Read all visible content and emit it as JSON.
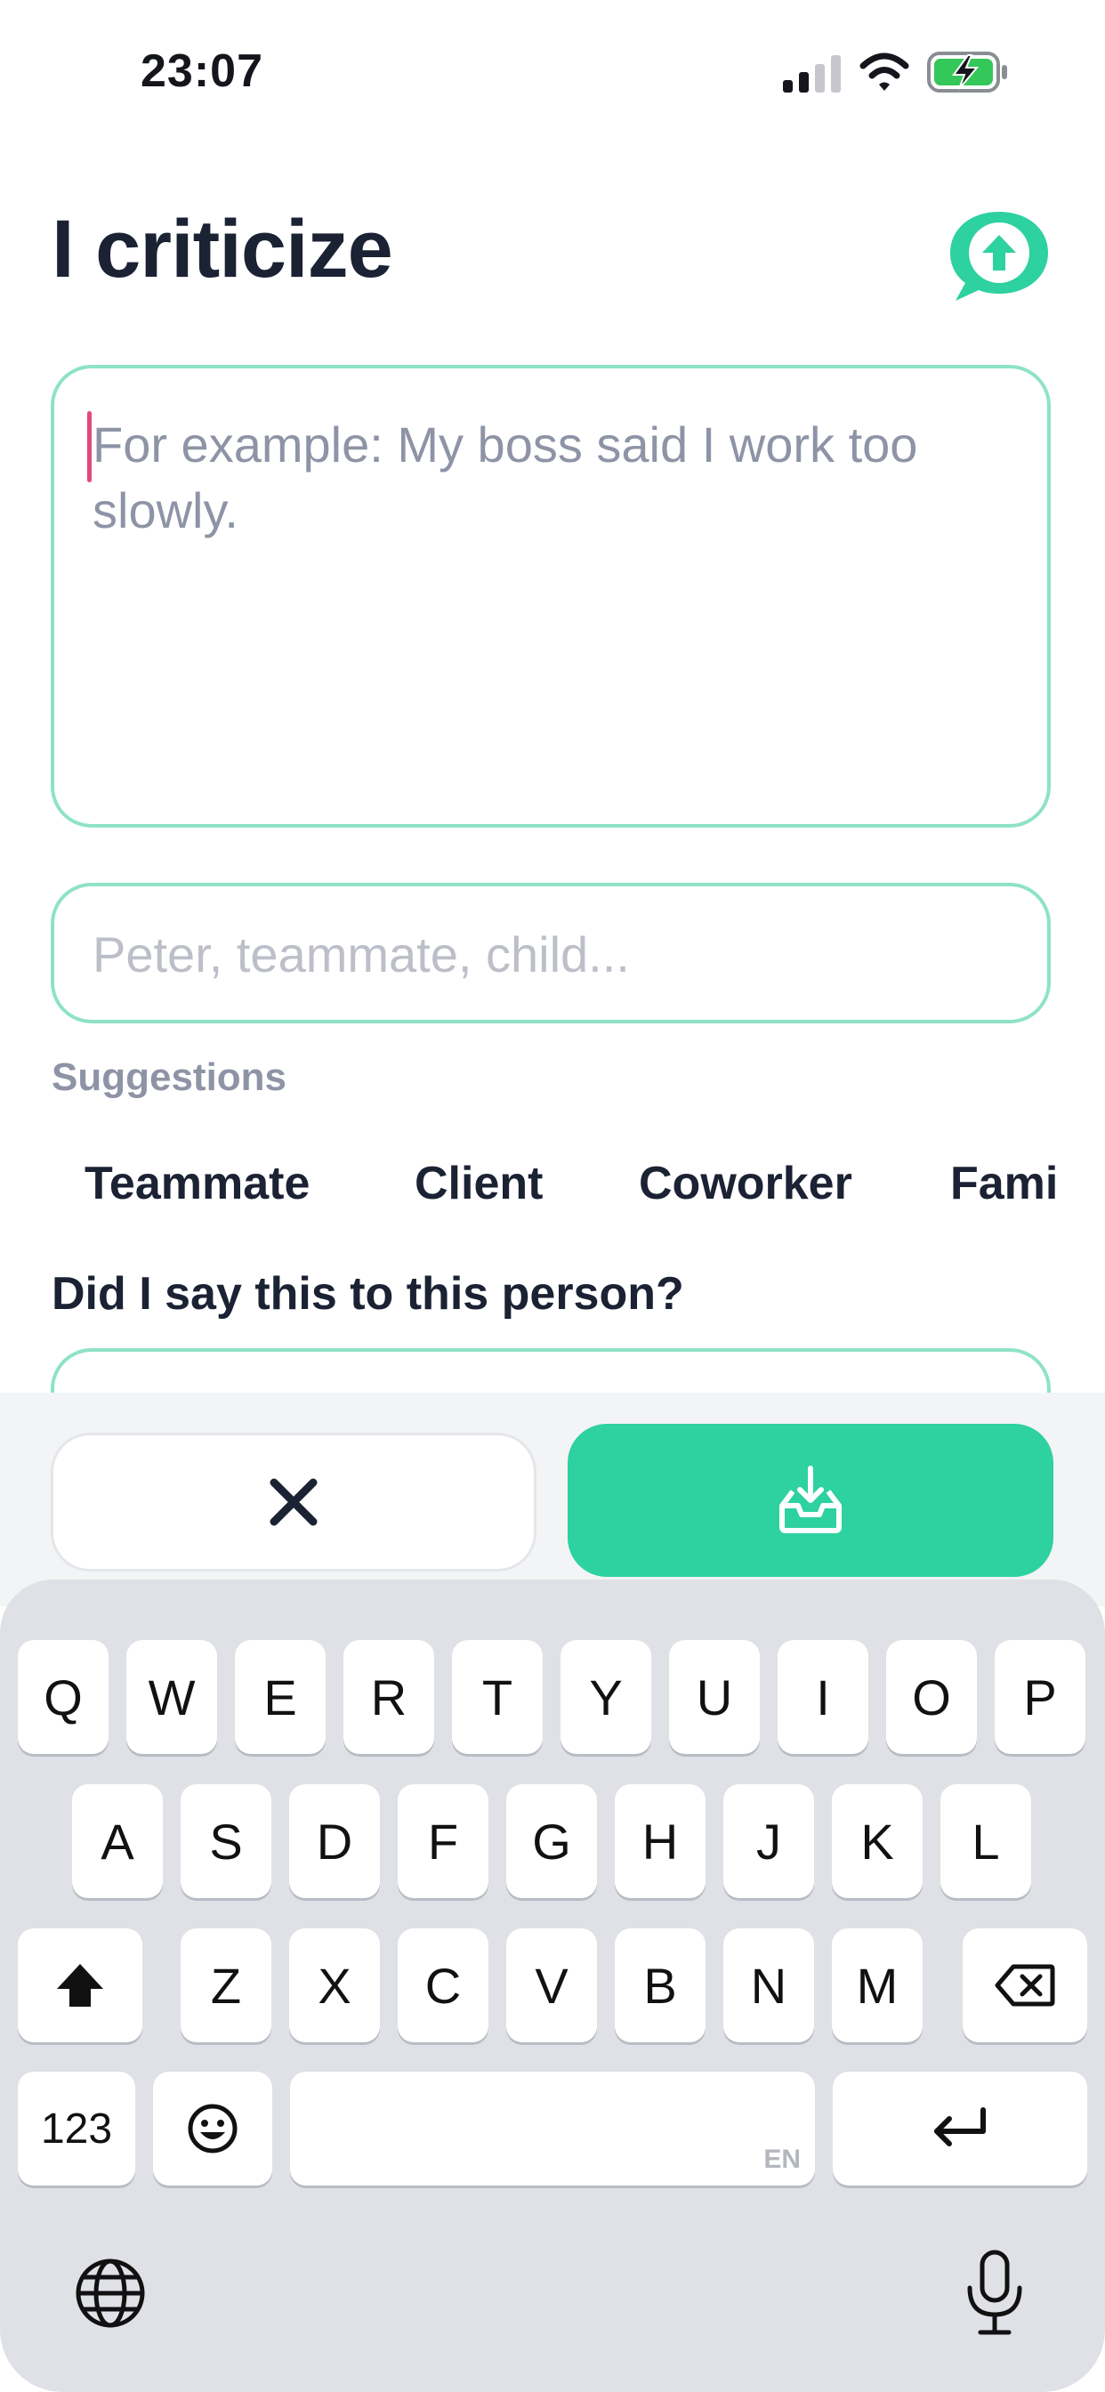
{
  "status_bar": {
    "time": "23:07"
  },
  "header": {
    "title": "I criticize"
  },
  "form": {
    "criticism_placeholder": "For example: My boss said I work too slowly.",
    "person_placeholder": "Peter, teammate, child...",
    "suggestions_label": "Suggestions",
    "suggestions": [
      "Teammate",
      "Client",
      "Coworker",
      "Family"
    ],
    "question": "Did I say this to this person?"
  },
  "keyboard": {
    "row1": [
      "Q",
      "W",
      "E",
      "R",
      "T",
      "Y",
      "U",
      "I",
      "O",
      "P"
    ],
    "row2": [
      "A",
      "S",
      "D",
      "F",
      "G",
      "H",
      "J",
      "K",
      "L"
    ],
    "row3": [
      "Z",
      "X",
      "C",
      "V",
      "B",
      "N",
      "M"
    ],
    "numbers_label": "123",
    "language_tag": "EN"
  },
  "colors": {
    "accent": "#2ed1a0",
    "input_border": "#8ee3c4",
    "text_dark": "#1b2233",
    "text_muted": "#8e94a6",
    "keyboard_bg": "#dfe1e6"
  }
}
